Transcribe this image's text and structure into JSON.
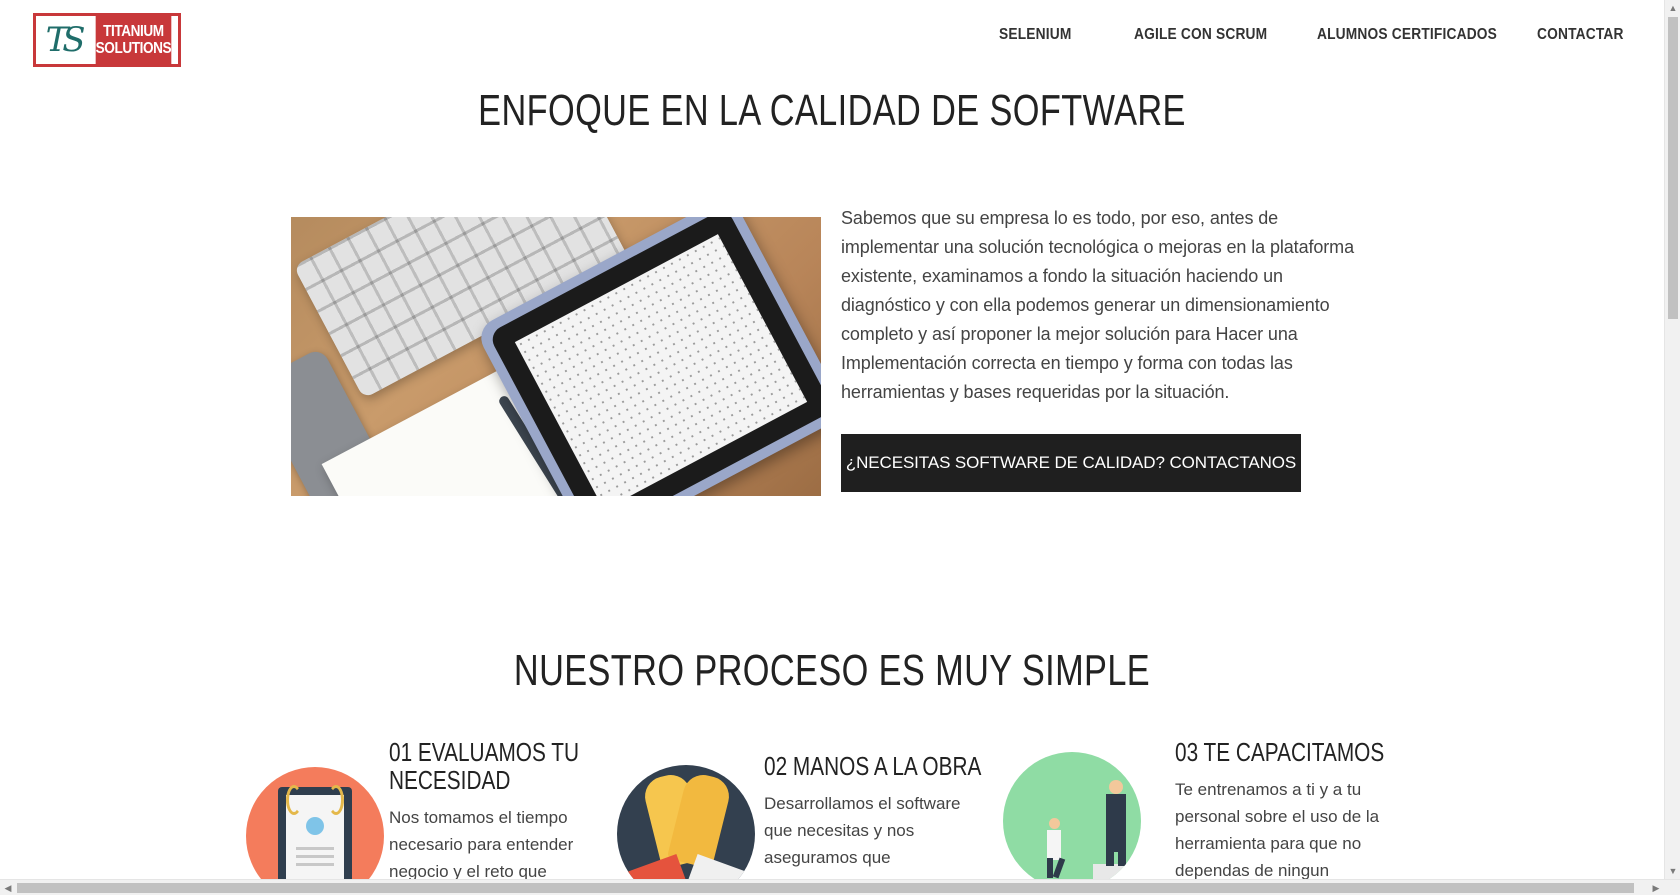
{
  "header": {
    "logo_mark": "TS",
    "logo_line1": "TITANIUM",
    "logo_line2": "SOLUTIONS",
    "nav": [
      "SELENIUM",
      "AGILE CON SCRUM",
      "ALUMNOS CERTIFICADOS",
      "CONTACTAR"
    ]
  },
  "section1": {
    "title": "ENFOQUE EN LA CALIDAD DE SOFTWARE",
    "paragraph": "Sabemos que su empresa lo es todo, por eso, antes de implementar una solución tecnológica o mejoras en la plataforma existente, examinamos a fondo la situación haciendo un diagnóstico y con ella podemos generar un dimensionamiento completo y así proponer la mejor solución para Hacer una Implementación correcta en tiempo y forma con todas las herramientas y bases requeridas por la situación.",
    "cta_label": "¿NECESITAS SOFTWARE DE CALIDAD? CONTACTANOS"
  },
  "section2": {
    "title": "NUESTRO PROCESO ES MUY SIMPLE",
    "steps": [
      {
        "title_line1": "01 EVALUAMOS TU",
        "title_line2": "NECESIDAD",
        "text": "Nos tomamos el tiempo necesario para entender negocio y el reto que"
      },
      {
        "title_line1": "02 MANOS A LA OBRA",
        "text": "Desarrollamos el software que necesitas y nos aseguramos que"
      },
      {
        "title_line1": "03 TE CAPACITAMOS",
        "text": "Te entrenamos a ti y a tu personal sobre el uso de la herramienta para que no dependas de ningun"
      }
    ]
  },
  "icons": {
    "step1": "certificate-icon",
    "step2": "high-five-icon",
    "step3": "career-growth-icon"
  },
  "colors": {
    "brand_red": "#c8383a",
    "brand_teal": "#1f6d6a",
    "cta_bg": "#1f1f1f",
    "step1_bg": "#f47c5c",
    "step2_bg": "#33404f",
    "step3_bg": "#8fdca4"
  }
}
